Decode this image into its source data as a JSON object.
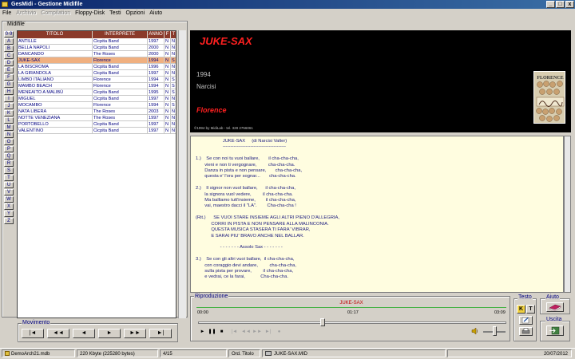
{
  "window": {
    "title": "GesMidi - Gestione Midifile",
    "buttons": [
      "_",
      "□",
      "x"
    ]
  },
  "menu": [
    {
      "label": "File",
      "enabled": true
    },
    {
      "label": "Archivio",
      "enabled": false
    },
    {
      "label": "Compilation",
      "enabled": false
    },
    {
      "label": "Floppy-Disk",
      "enabled": true
    },
    {
      "label": "Testi",
      "enabled": true
    },
    {
      "label": "Opzioni",
      "enabled": true
    },
    {
      "label": "Aiuto",
      "enabled": true
    }
  ],
  "midifile": {
    "label": "Midifile",
    "letters": [
      "0-9",
      "A",
      "B",
      "C",
      "D",
      "E",
      "F",
      "G",
      "H",
      "I",
      "J",
      "K",
      "L",
      "M",
      "N",
      "O",
      "P",
      "Q",
      "R",
      "S",
      "T",
      "U",
      "V",
      "W",
      "X",
      "Y",
      "Z"
    ],
    "columns": [
      "TITOLO",
      "INTERPRETE",
      "ANNO",
      "F",
      "T"
    ],
    "rows": [
      {
        "title": "ANTILLE",
        "artist": "Cicpita Band",
        "year": "1997",
        "f": "N",
        "t": "N"
      },
      {
        "title": "BELLA NAPOLI",
        "artist": "Cicpita Band",
        "year": "2000",
        "f": "N",
        "t": "N"
      },
      {
        "title": "DANCANDO",
        "artist": "The Roses",
        "year": "2000",
        "f": "N",
        "t": "N"
      },
      {
        "title": "JUKE-SAX",
        "artist": "Florence",
        "year": "1994",
        "f": "N",
        "t": "S"
      },
      {
        "title": "LA BISCROMA",
        "artist": "Cicpita Band",
        "year": "1996",
        "f": "N",
        "t": "N"
      },
      {
        "title": "LA GIRANDOLA",
        "artist": "Cicpita Band",
        "year": "1997",
        "f": "N",
        "t": "N"
      },
      {
        "title": "LIMBO ITALIANO",
        "artist": "Florence",
        "year": "1994",
        "f": "N",
        "t": "S"
      },
      {
        "title": "MAMBO BEACH",
        "artist": "Florence",
        "year": "1994",
        "f": "N",
        "t": "S"
      },
      {
        "title": "MENEAITO A MALIBÙ",
        "artist": "Cicpita Band",
        "year": "1995",
        "f": "N",
        "t": "S"
      },
      {
        "title": "MIGUEL",
        "artist": "Cicpita Band",
        "year": "1997",
        "f": "N",
        "t": "N"
      },
      {
        "title": "MOCAMBO",
        "artist": "Florence",
        "year": "1994",
        "f": "N",
        "t": "S"
      },
      {
        "title": "NATA LIBERA",
        "artist": "The Roses",
        "year": "2003",
        "f": "N",
        "t": "N"
      },
      {
        "title": "NOTTE VENEZIANA",
        "artist": "The Roses",
        "year": "1997",
        "f": "N",
        "t": "N"
      },
      {
        "title": "PORTOBELLO",
        "artist": "Cicpita Band",
        "year": "1997",
        "f": "N",
        "t": "N"
      },
      {
        "title": "VALENTINO",
        "artist": "Cicpita Band",
        "year": "1997",
        "f": "N",
        "t": "N"
      }
    ],
    "selected_index": 3
  },
  "movimento": {
    "label": "Movimento",
    "buttons": [
      "|◄",
      "◄◄",
      "◄",
      "►",
      "►►",
      "►|"
    ]
  },
  "song": {
    "title": "JUKE-SAX",
    "year": "1994",
    "author": "Narcisi",
    "artist": "Florence",
    "copyright": "©1994 by MidiLab - tel. 328 2756061",
    "cover_label": "FLORENCE"
  },
  "lyrics": "                     JUKE-SAX     (di Narcisi Valter)\n                     -----------------------------------------\n\n1.)    Se con noi tu vuoi ballare,       il cha-cha-cha,\n       vieni e non ti vergognare,         cha-cha-cha.\n       Danza in pista e non pensare,       cha-cha-cha,\n       questa e' l'ora per sognar...       cha-cha-cha.\n\n2.)    Il signor non vuol ballare,      il cha-cha-cha,\n       la signora vuol vedere,         il cha-cha-cha.\n       Ma balliamo tutt'insieme,        il cha-cha-cha,\n       vai, maestro dacci il \"LA\".        Cha-cha-cha !\n\n(Rit.)      SE VUOI STARE INSIEME AGLI ALTRI PIENO D'ALLEGRIA,\n            CORRI IN PISTA E NON PENSARE ALLA MALINCONIA.\n            QUESTA MUSICA STASERA TI FARA' VIBRAR,\n            E SARAI PIU' BRAVO ANCHE NEL BALLAR.\n\n                   - - - - - - - Assolo Sax - - - - - - -\n\n3.)    Se con gli altri vuoi ballare,  il cha-cha-cha,\n       con coraggio devi andare,         cha-cha-cha,\n       sulla pista per provare,         il cha-cha-cha,\n       e vedrai, ce la farai,            Cha-cha-cha.",
  "riproduzione": {
    "label": "Riproduzione",
    "now_playing": "JUKE-SAX",
    "time_start": "00:00",
    "time_current": "01:17",
    "time_end": "03:09",
    "progress": 0.41,
    "volume": 0.45,
    "buttons": [
      "►",
      "❚❚",
      "■",
      "|◄",
      "◄◄",
      "►►",
      "►|",
      "●"
    ]
  },
  "testo": {
    "label": "Testo",
    "k_label": "K",
    "t_label": "T"
  },
  "aiuto": {
    "label": "Aiuto"
  },
  "uscita": {
    "label": "Uscita"
  },
  "status": {
    "file": "DemoArch21.mdb",
    "size": "220 Kbyte  (225280 bytes)",
    "position": "4/15",
    "order": "Ord. Titolo",
    "midi": "JUKE-SAX.MID",
    "date": "20/07/2012"
  }
}
